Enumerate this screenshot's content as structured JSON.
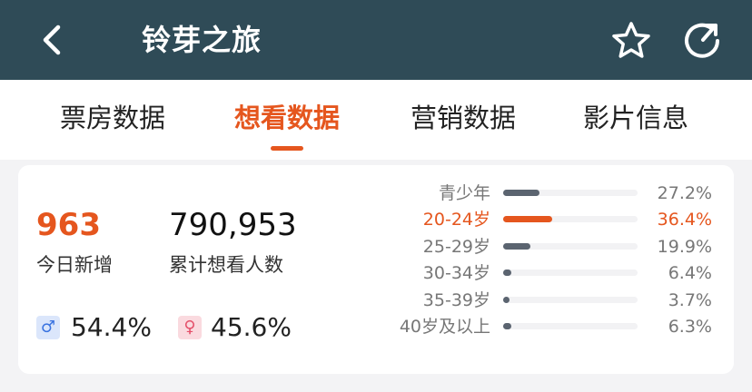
{
  "header": {
    "title": "铃芽之旅",
    "back_icon": "chevron-left-icon",
    "favorite_icon": "star-outline-icon",
    "share_icon": "share-arrow-icon",
    "background_color": "#2f4b57"
  },
  "tabs": [
    {
      "label": "票房数据",
      "active": false
    },
    {
      "label": "想看数据",
      "active": true
    },
    {
      "label": "营销数据",
      "active": false
    },
    {
      "label": "影片信息",
      "active": false
    }
  ],
  "accent_color": "#e5561e",
  "stats": {
    "today_new": {
      "value": "963",
      "label": "今日新增"
    },
    "total_want": {
      "value": "790,953",
      "label": "累计想看人数"
    }
  },
  "gender": {
    "male": {
      "icon": "male-icon",
      "symbol": "♂",
      "percent": "54.4%"
    },
    "female": {
      "icon": "female-icon",
      "symbol": "♀",
      "percent": "45.6%"
    }
  },
  "age_distribution": [
    {
      "label": "青少年",
      "percent": "27.2%",
      "value": 27.2,
      "highlight": false
    },
    {
      "label": "20-24岁",
      "percent": "36.4%",
      "value": 36.4,
      "highlight": true
    },
    {
      "label": "25-29岁",
      "percent": "19.9%",
      "value": 19.9,
      "highlight": false
    },
    {
      "label": "30-34岁",
      "percent": "6.4%",
      "value": 6.4,
      "highlight": false
    },
    {
      "label": "35-39岁",
      "percent": "3.7%",
      "value": 3.7,
      "highlight": false
    },
    {
      "label": "40岁及以上",
      "percent": "6.3%",
      "value": 6.3,
      "highlight": false
    }
  ]
}
